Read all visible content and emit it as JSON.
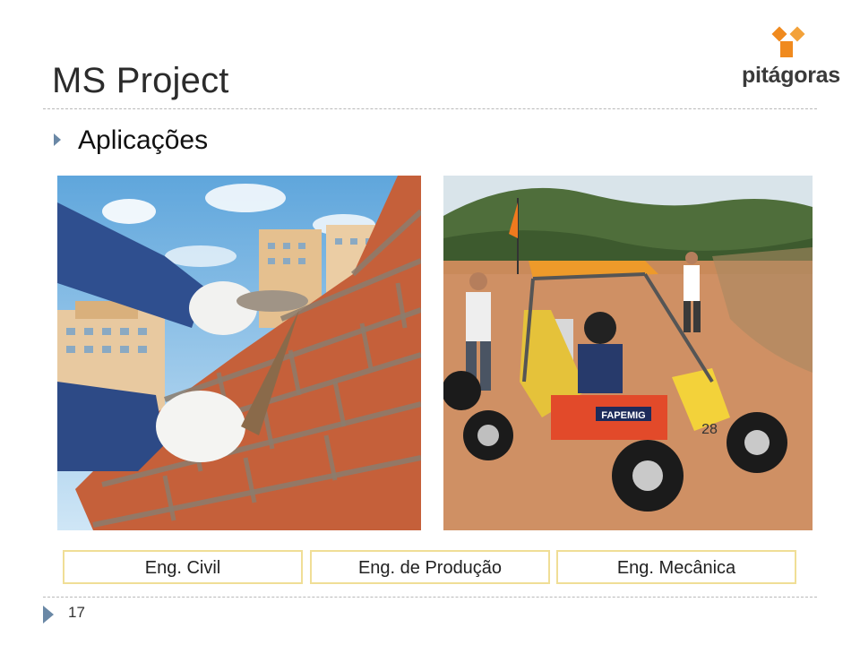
{
  "slide": {
    "title": "MS Project",
    "bullet": "Aplicações",
    "page_number": "17"
  },
  "logo": {
    "text": "pitágoras",
    "color": "#f08a1e"
  },
  "images": [
    {
      "description_name": "bricklaying-photo"
    },
    {
      "description_name": "offroad-buggy-photo",
      "car_number": "28",
      "sponsor": "FAPEMIG"
    }
  ],
  "captions": [
    "Eng. Civil",
    "Eng. de Produção",
    "Eng. Mecânica"
  ],
  "colors": {
    "caption_border": "#f0de96",
    "bullet": "#6a88a6",
    "divider": "#b9b9b9"
  }
}
